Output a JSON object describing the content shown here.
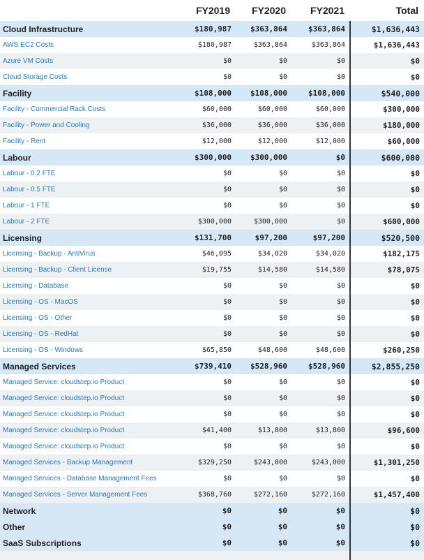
{
  "columns": [
    "FY2019",
    "FY2020",
    "FY2021",
    "Total"
  ],
  "rows": [
    {
      "type": "cat",
      "name": "Cloud Infrastructure",
      "v": [
        "$180,987",
        "$363,864",
        "$363,864",
        "$1,636,443"
      ]
    },
    {
      "type": "item",
      "name": "AWS EC2 Costs",
      "v": [
        "$180,987",
        "$363,864",
        "$363,864",
        "$1,636,443"
      ]
    },
    {
      "type": "item",
      "name": "Azure VM Costs",
      "v": [
        "$0",
        "$0",
        "$0",
        "$0"
      ]
    },
    {
      "type": "item",
      "name": "Cloud Storage Costs",
      "v": [
        "$0",
        "$0",
        "$0",
        "$0"
      ]
    },
    {
      "type": "cat",
      "name": "Facility",
      "v": [
        "$108,000",
        "$108,000",
        "$108,000",
        "$540,000"
      ]
    },
    {
      "type": "item",
      "name": "Facility - Commercial Rack Costs",
      "v": [
        "$60,000",
        "$60,000",
        "$60,000",
        "$300,000"
      ]
    },
    {
      "type": "item",
      "name": "Facility - Power and Cooling",
      "v": [
        "$36,000",
        "$36,000",
        "$36,000",
        "$180,000"
      ]
    },
    {
      "type": "item",
      "name": "Facility - Rent",
      "v": [
        "$12,000",
        "$12,000",
        "$12,000",
        "$60,000"
      ]
    },
    {
      "type": "cat",
      "name": "Labour",
      "v": [
        "$300,000",
        "$300,000",
        "$0",
        "$600,000"
      ]
    },
    {
      "type": "item",
      "name": "Labour - 0.2 FTE",
      "v": [
        "$0",
        "$0",
        "$0",
        "$0"
      ]
    },
    {
      "type": "item",
      "name": "Labour - 0.5 FTE",
      "v": [
        "$0",
        "$0",
        "$0",
        "$0"
      ]
    },
    {
      "type": "item",
      "name": "Labour - 1 FTE",
      "v": [
        "$0",
        "$0",
        "$0",
        "$0"
      ]
    },
    {
      "type": "item",
      "name": "Labour - 2 FTE",
      "v": [
        "$300,000",
        "$300,000",
        "$0",
        "$600,000"
      ]
    },
    {
      "type": "cat",
      "name": "Licensing",
      "v": [
        "$131,700",
        "$97,200",
        "$97,200",
        "$520,500"
      ]
    },
    {
      "type": "item",
      "name": "Licensing - Backup - AntiVirus",
      "v": [
        "$46,095",
        "$34,020",
        "$34,020",
        "$182,175"
      ]
    },
    {
      "type": "item",
      "name": "Licensing - Backup - Client License",
      "v": [
        "$19,755",
        "$14,580",
        "$14,580",
        "$78,075"
      ]
    },
    {
      "type": "item",
      "name": "Licensing - Database",
      "v": [
        "$0",
        "$0",
        "$0",
        "$0"
      ]
    },
    {
      "type": "item",
      "name": "Licensing - OS - MacOS",
      "v": [
        "$0",
        "$0",
        "$0",
        "$0"
      ]
    },
    {
      "type": "item",
      "name": "Licensing - OS - Other",
      "v": [
        "$0",
        "$0",
        "$0",
        "$0"
      ]
    },
    {
      "type": "item",
      "name": "Licensing - OS - RedHat",
      "v": [
        "$0",
        "$0",
        "$0",
        "$0"
      ]
    },
    {
      "type": "item",
      "name": "Licensing - OS - Windows",
      "v": [
        "$65,850",
        "$48,600",
        "$48,600",
        "$260,250"
      ]
    },
    {
      "type": "cat",
      "name": "Managed Services",
      "v": [
        "$739,410",
        "$528,960",
        "$528,960",
        "$2,855,250"
      ]
    },
    {
      "type": "item",
      "name": "Managed Service: cloudstep.io Product",
      "v": [
        "$0",
        "$0",
        "$0",
        "$0"
      ]
    },
    {
      "type": "item",
      "name": "Managed Service: cloudstep.io Product",
      "v": [
        "$0",
        "$0",
        "$0",
        "$0"
      ]
    },
    {
      "type": "item",
      "name": "Managed Service: cloudstep.io Product",
      "v": [
        "$0",
        "$0",
        "$0",
        "$0"
      ]
    },
    {
      "type": "item",
      "name": "Managed Service: cloudstep.io Product",
      "v": [
        "$41,400",
        "$13,800",
        "$13,800",
        "$96,600"
      ]
    },
    {
      "type": "item",
      "name": "Managed Service: cloudstep.io Product",
      "v": [
        "$0",
        "$0",
        "$0",
        "$0"
      ]
    },
    {
      "type": "item",
      "name": "Managed Services - Backup Management",
      "v": [
        "$329,250",
        "$243,000",
        "$243,000",
        "$1,301,250"
      ]
    },
    {
      "type": "item",
      "name": "Managed Services - Database Management Fees",
      "v": [
        "$0",
        "$0",
        "$0",
        "$0"
      ]
    },
    {
      "type": "item",
      "name": "Managed Services - Server Management Fees",
      "v": [
        "$368,760",
        "$272,160",
        "$272,160",
        "$1,457,400"
      ]
    },
    {
      "type": "cat",
      "name": "Network",
      "v": [
        "$0",
        "$0",
        "$0",
        "$0"
      ]
    },
    {
      "type": "cat",
      "name": "Other",
      "v": [
        "$0",
        "$0",
        "$0",
        "$0"
      ]
    },
    {
      "type": "cat",
      "name": "SaaS Subscriptions",
      "v": [
        "$0",
        "$0",
        "$0",
        "$0"
      ]
    }
  ],
  "colors": {
    "category_bg": "#d6e8f6",
    "stripe_bg": "#eef1f4",
    "link": "#2a7ab8"
  }
}
